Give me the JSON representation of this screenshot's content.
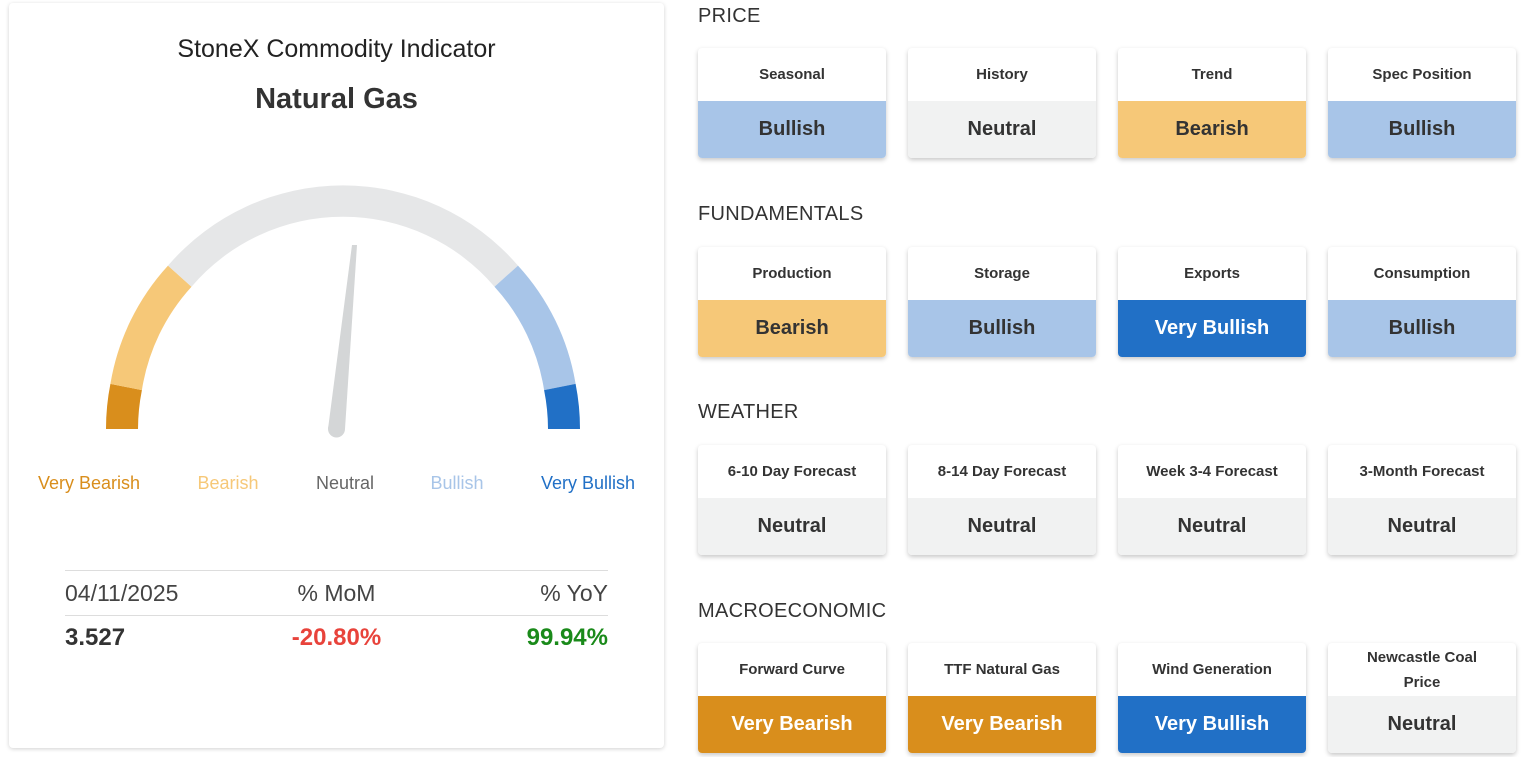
{
  "indicator": {
    "title": "StoneX Commodity Indicator",
    "commodity": "Natural Gas",
    "needle_value": 0.53,
    "gauge_labels": [
      {
        "text": "Very Bearish",
        "color": "#d98e1c"
      },
      {
        "text": "Bearish",
        "color": "#f6c878"
      },
      {
        "text": "Neutral",
        "color": "#666666"
      },
      {
        "text": "Bullish",
        "color": "#a8c5e8"
      },
      {
        "text": "Very Bullish",
        "color": "#2170c6"
      }
    ],
    "stats": {
      "date": "04/11/2025",
      "mom_label": "% MoM",
      "yoy_label": "% YoY",
      "price": "3.527",
      "mom": "-20.80%",
      "yoy": "99.94%",
      "mom_color": "#e8433b",
      "yoy_color": "#1a8a1a"
    }
  },
  "colors": {
    "very_bearish": "#d98e1c",
    "bearish": "#f6c878",
    "neutral": "#f1f2f2",
    "bullish": "#a8c5e8",
    "very_bullish": "#2170c6"
  },
  "sections": [
    {
      "label": "PRICE",
      "tiles": [
        {
          "name": "Seasonal",
          "value": "Bullish"
        },
        {
          "name": "History",
          "value": "Neutral"
        },
        {
          "name": "Trend",
          "value": "Bearish"
        },
        {
          "name": "Spec Position",
          "value": "Bullish"
        }
      ]
    },
    {
      "label": "FUNDAMENTALS",
      "tiles": [
        {
          "name": "Production",
          "value": "Bearish"
        },
        {
          "name": "Storage",
          "value": "Bullish"
        },
        {
          "name": "Exports",
          "value": "Very Bullish"
        },
        {
          "name": "Consumption",
          "value": "Bullish"
        }
      ]
    },
    {
      "label": "WEATHER",
      "tiles": [
        {
          "name": "6-10 Day Forecast",
          "value": "Neutral"
        },
        {
          "name": "8-14 Day Forecast",
          "value": "Neutral"
        },
        {
          "name": "Week 3-4 Forecast",
          "value": "Neutral"
        },
        {
          "name": "3-Month Forecast",
          "value": "Neutral"
        }
      ]
    },
    {
      "label": "MACROECONOMIC",
      "tiles": [
        {
          "name": "Forward Curve",
          "value": "Very Bearish"
        },
        {
          "name": "TTF Natural Gas",
          "value": "Very Bearish"
        },
        {
          "name": "Wind Generation",
          "value": "Very Bullish"
        },
        {
          "name": "Newcastle Coal Price",
          "value": "Neutral"
        }
      ]
    }
  ]
}
